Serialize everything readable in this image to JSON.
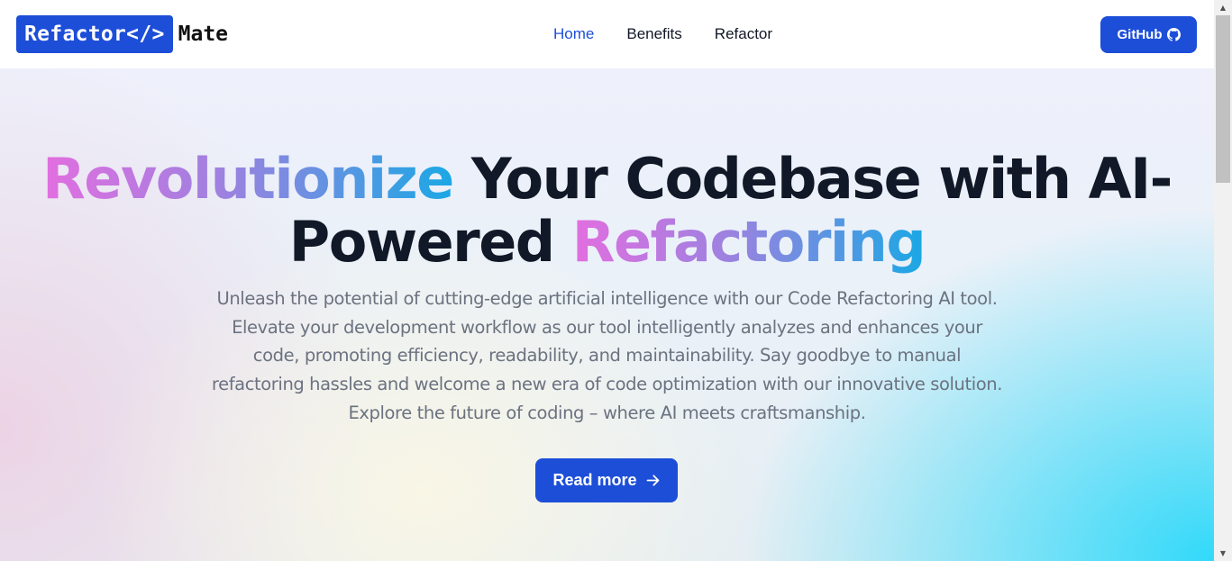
{
  "header": {
    "logo_main": "Refactor</>",
    "logo_suffix": "Mate",
    "nav": [
      {
        "label": "Home",
        "active": true
      },
      {
        "label": "Benefits",
        "active": false
      },
      {
        "label": "Refactor",
        "active": false
      }
    ],
    "github_label": "GitHub",
    "github_icon": "github-icon"
  },
  "hero": {
    "headline_grad_1": "Revolutionize",
    "headline_plain_1": " Your Codebase with AI-",
    "headline_plain_2": "Powered ",
    "headline_grad_2": "Refactoring",
    "subtitle": "Unleash the potential of cutting-edge artificial intelligence with our Code Refactoring AI tool. Elevate your development workflow as our tool intelligently analyzes and enhances your code, promoting efficiency, readability, and maintainability. Say goodbye to manual refactoring hassles and welcome a new era of code optimization with our innovative solution. Explore the future of coding – where AI meets craftsmanship.",
    "cta_label": "Read more",
    "cta_icon": "arrow-right-icon"
  },
  "colors": {
    "accent": "#1d4ed8",
    "heading": "#111827",
    "body_text": "#6b7280",
    "gradient_start": "#e36ee0",
    "gradient_end": "#1aa8e4"
  }
}
